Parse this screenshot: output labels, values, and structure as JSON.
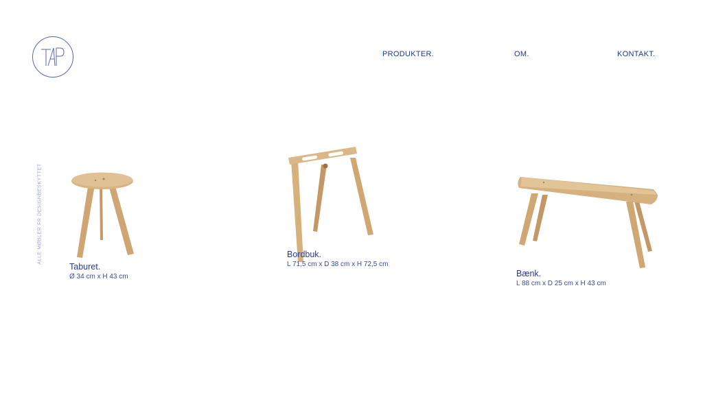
{
  "logo": {
    "text": "TAP"
  },
  "nav": [
    {
      "label": "PRODUKTER."
    },
    {
      "label": "OM."
    },
    {
      "label": "KONTAKT."
    }
  ],
  "side_text": "ALLE MØBLER FR DESIGNBESKYTTET",
  "products": [
    {
      "name": "Taburet.",
      "dims": "Ø 34 cm x H 43 cm",
      "image": "stool"
    },
    {
      "name": "Bordbuk.",
      "dims": "L 71,5 cm x D 38 cm x H 72,5 cm",
      "image": "trestle"
    },
    {
      "name": "Bænk.",
      "dims": "L 88 cm x D 25 cm x H 43 cm",
      "image": "bench"
    }
  ],
  "colors": {
    "accent": "#2b3b8f",
    "wood": "#d2ab7c",
    "wood_dark": "#b88d5c"
  }
}
